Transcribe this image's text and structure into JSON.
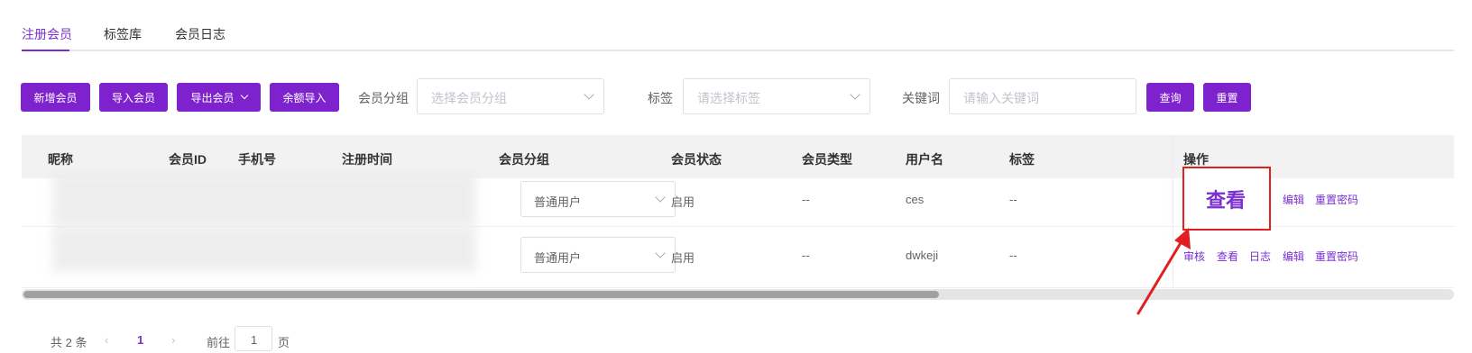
{
  "tabs": [
    {
      "label": "注册会员",
      "active": true
    },
    {
      "label": "标签库",
      "active": false
    },
    {
      "label": "会员日志",
      "active": false
    }
  ],
  "toolbar": {
    "add_member": "新增会员",
    "import_member": "导入会员",
    "export_member": "导出会员",
    "balance_import": "余额导入",
    "group_label": "会员分组",
    "group_placeholder": "选择会员分组",
    "tag_label": "标签",
    "tag_placeholder": "请选择标签",
    "keyword_label": "关键词",
    "keyword_placeholder": "请输入关键词",
    "query": "查询",
    "reset": "重置"
  },
  "table": {
    "headers": {
      "nickname": "昵称",
      "member_id": "会员ID",
      "phone": "手机号",
      "reg_time": "注册时间",
      "group": "会员分组",
      "status": "会员状态",
      "type": "会员类型",
      "username": "用户名",
      "tags": "标签",
      "actions": "操作"
    },
    "rows": [
      {
        "group": "普通用户",
        "status": "启用",
        "type": "--",
        "username": "ces",
        "tags": "--"
      },
      {
        "group": "普通用户",
        "status": "启用",
        "type": "--",
        "username": "dwkeji",
        "tags": "--"
      }
    ],
    "row1_actions": {
      "highlighted_view": "查看",
      "edit": "编辑",
      "reset_password": "重置密码"
    },
    "row2_actions": {
      "review": "审核",
      "view": "查看",
      "log": "日志",
      "edit": "编辑",
      "reset_password": "重置密码"
    }
  },
  "pagination": {
    "total": "共 2 条",
    "prev": "‹",
    "current_page": "1",
    "next": "›",
    "goto_prefix": "前往",
    "goto_value": "1",
    "goto_suffix": "页"
  },
  "colors": {
    "accent": "#7e22ce",
    "highlight": "#e02020"
  }
}
